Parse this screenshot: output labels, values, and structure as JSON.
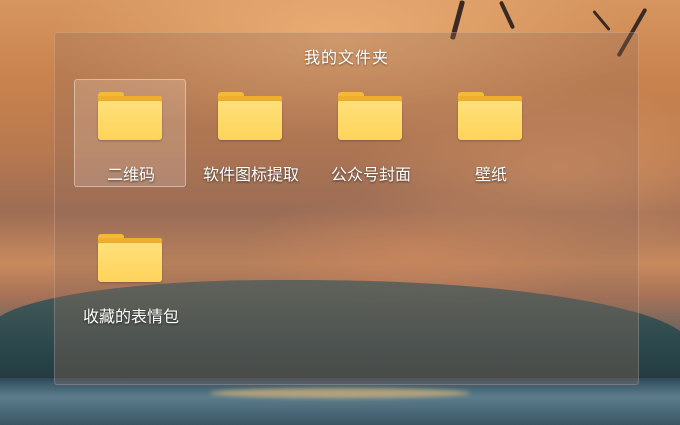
{
  "window": {
    "title": "我的文件夹"
  },
  "folders": [
    {
      "label": "二维码",
      "icon": "folder-icon",
      "selected": true
    },
    {
      "label": "软件图标提取",
      "icon": "folder-icon",
      "selected": false
    },
    {
      "label": "公众号封面",
      "icon": "folder-icon",
      "selected": false
    },
    {
      "label": "壁纸",
      "icon": "folder-icon",
      "selected": false
    },
    {
      "label": "收藏的表情包",
      "icon": "folder-icon",
      "selected": false
    }
  ],
  "colors": {
    "folder_front": "#fdd35a",
    "folder_back": "#f0ae2e",
    "window_overlay": "rgba(150,110,90,0.32)"
  }
}
